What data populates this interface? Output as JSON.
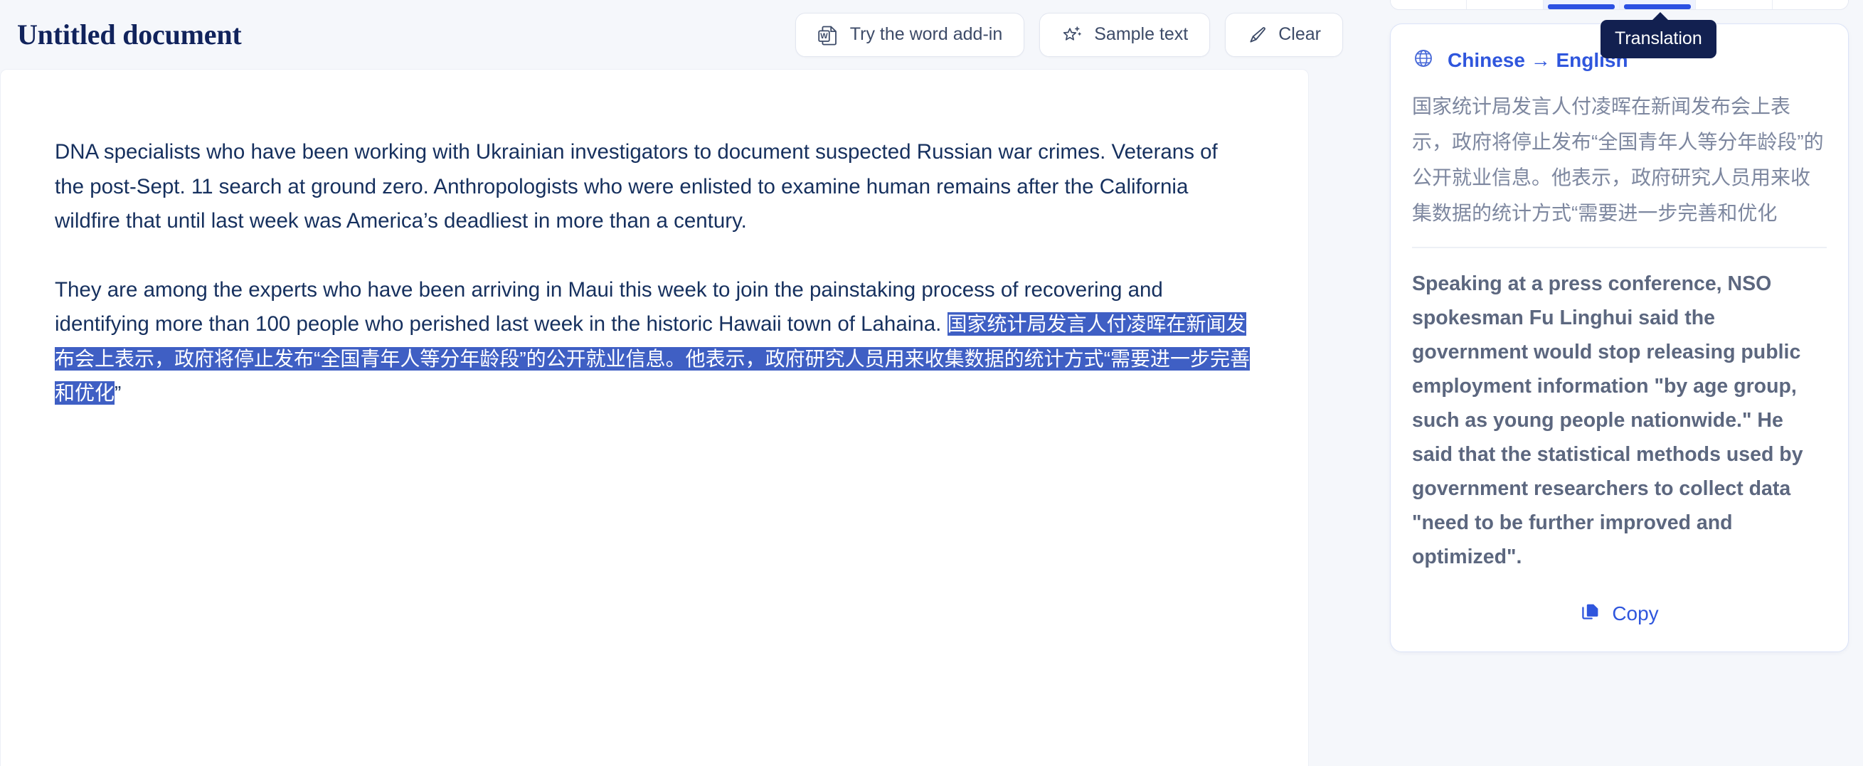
{
  "editor": {
    "title": "Untitled document",
    "actions": [
      {
        "label": "Try the word add-in",
        "icon": "word-document-icon"
      },
      {
        "label": "Sample text",
        "icon": "sparkle-star-icon"
      },
      {
        "label": "Clear",
        "icon": "brush-icon"
      }
    ],
    "paragraphs": [
      {
        "id": "p1",
        "text": "DNA specialists who have been working with Ukrainian investigators to document suspected Russian war crimes. Veterans of the post-Sept. 11 search at ground zero. Anthropologists who were enlisted to examine human remains after the California wildfire that until last week was America’s deadliest in more than a century."
      },
      {
        "id": "p2",
        "lead": "They are among the experts who have been arriving in Maui this week to join the painstaking process of recovering and identifying more than 100 people who perished last week in the historic Hawaii town of Lahaina.",
        "selected": "国家统计局发言人付凌晖在新闻发布会上表示，政府将停止发布“全国青年人等分年龄段”的公开就业信息。他表示，政府研究人员用来收集数据的统计方式“需要进一步完善和优化",
        "trailing": "”"
      }
    ]
  },
  "right_panel": {
    "tabs": [
      {
        "id": "tab-1",
        "active": false
      },
      {
        "id": "tab-2",
        "active": false
      },
      {
        "id": "tab-3",
        "active": true
      },
      {
        "id": "tab-4",
        "active": true
      },
      {
        "id": "tab-5",
        "active": false
      },
      {
        "id": "tab-6",
        "active": false
      }
    ],
    "tooltip": "Translation",
    "translation_card": {
      "language_pair": "Chinese → English",
      "globe_icon": "globe-icon",
      "source_text": "国家统计局发言人付凌晖在新闻发布会上表示，政府将停止发布“全国青年人等分年龄段”的公开就业信息。他表示，政府研究人员用来收集数据的统计方式“需要进一步完善和优化",
      "target_text": "Speaking at a press conference, NSO spokesman Fu Linghui said the government would stop releasing public employment information \"by age group, such as young people nationwide.\" He said that the statistical methods used by government researchers to collect data \"need to be further improved and optimized\".",
      "copy_label": "Copy",
      "copy_icon": "copy-icon"
    }
  },
  "colors": {
    "page_background": "#f5f7fb",
    "sheet_background": "#ffffff",
    "title_navy": "#11235c",
    "body_navy": "#16305e",
    "selection_blue": "#3f5fc4",
    "accent_blue": "#2f56dd",
    "tab_active_blue": "#2b50e2",
    "tooltip_navy": "#122050",
    "source_gray": "#7d879f",
    "target_gray": "#5c677f"
  }
}
